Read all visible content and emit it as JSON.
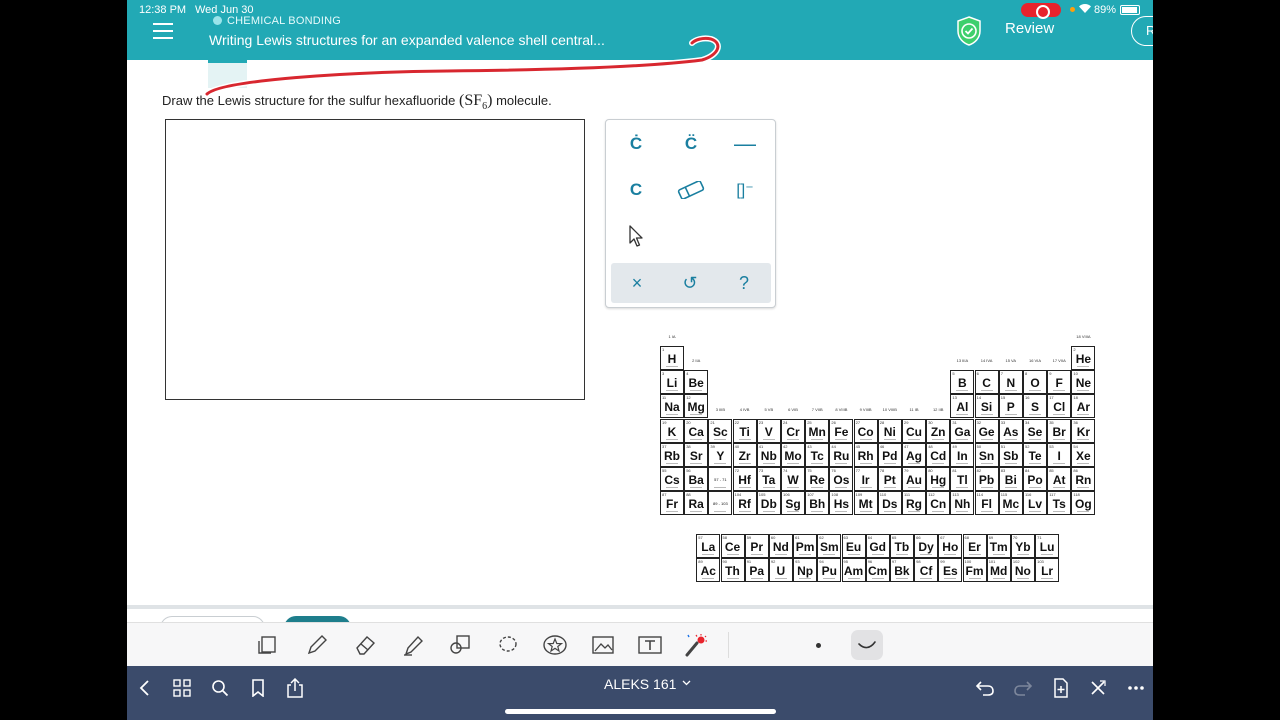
{
  "status_bar": {
    "time": "12:38 PM",
    "date": "Wed Jun 30",
    "battery": "89%"
  },
  "header": {
    "topic": "CHEMICAL BONDING",
    "title": "Writing Lewis structures for an expanded valence shell central...",
    "review_label": "Review",
    "right_button_label": "R",
    "accent": "#22a9b5"
  },
  "question": {
    "prefix": "Draw the Lewis structure for the sulfur hexafluoride",
    "formula_open": "(",
    "formula_main": "SF",
    "formula_sub": "6",
    "formula_close": ")",
    "suffix": "molecule."
  },
  "palette": {
    "tools": [
      {
        "id": "single-electron",
        "glyph": "Ċ",
        "icon": "single-dot-atom-icon"
      },
      {
        "id": "lone-pair",
        "glyph": "C̈",
        "icon": "lone-pair-atom-icon"
      },
      {
        "id": "bond",
        "glyph": "—",
        "icon": "bond-line-icon"
      },
      {
        "id": "atom",
        "glyph": "C",
        "icon": "atom-icon"
      },
      {
        "id": "eraser",
        "glyph": "",
        "icon": "eraser-icon"
      },
      {
        "id": "bracket",
        "glyph": "[]⁻",
        "icon": "bracket-charge-icon"
      },
      {
        "id": "select",
        "glyph": "",
        "icon": "cursor-icon"
      }
    ],
    "bottom": [
      {
        "id": "clear",
        "glyph": "×",
        "icon": "close-icon"
      },
      {
        "id": "undo",
        "glyph": "↺",
        "icon": "undo-icon"
      },
      {
        "id": "help",
        "glyph": "?",
        "icon": "help-icon"
      }
    ]
  },
  "periodic_table": {
    "main": [
      [
        {
          "n": 1,
          "s": "H",
          "c": 1
        },
        {
          "n": 2,
          "s": "He",
          "c": 18
        }
      ],
      [
        {
          "n": 3,
          "s": "Li",
          "c": 1
        },
        {
          "n": 4,
          "s": "Be",
          "c": 2
        },
        {
          "n": 5,
          "s": "B",
          "c": 13
        },
        {
          "n": 6,
          "s": "C",
          "c": 14
        },
        {
          "n": 7,
          "s": "N",
          "c": 15
        },
        {
          "n": 8,
          "s": "O",
          "c": 16
        },
        {
          "n": 9,
          "s": "F",
          "c": 17
        },
        {
          "n": 10,
          "s": "Ne",
          "c": 18
        }
      ],
      [
        {
          "n": 11,
          "s": "Na",
          "c": 1
        },
        {
          "n": 12,
          "s": "Mg",
          "c": 2
        },
        {
          "n": 13,
          "s": "Al",
          "c": 13
        },
        {
          "n": 14,
          "s": "Si",
          "c": 14
        },
        {
          "n": 15,
          "s": "P",
          "c": 15
        },
        {
          "n": 16,
          "s": "S",
          "c": 16
        },
        {
          "n": 17,
          "s": "Cl",
          "c": 17
        },
        {
          "n": 18,
          "s": "Ar",
          "c": 18
        }
      ],
      [
        {
          "n": 19,
          "s": "K",
          "c": 1
        },
        {
          "n": 20,
          "s": "Ca",
          "c": 2
        },
        {
          "n": 21,
          "s": "Sc",
          "c": 3
        },
        {
          "n": 22,
          "s": "Ti",
          "c": 4
        },
        {
          "n": 23,
          "s": "V",
          "c": 5
        },
        {
          "n": 24,
          "s": "Cr",
          "c": 6
        },
        {
          "n": 25,
          "s": "Mn",
          "c": 7
        },
        {
          "n": 26,
          "s": "Fe",
          "c": 8
        },
        {
          "n": 27,
          "s": "Co",
          "c": 9
        },
        {
          "n": 28,
          "s": "Ni",
          "c": 10
        },
        {
          "n": 29,
          "s": "Cu",
          "c": 11
        },
        {
          "n": 30,
          "s": "Zn",
          "c": 12
        },
        {
          "n": 31,
          "s": "Ga",
          "c": 13
        },
        {
          "n": 32,
          "s": "Ge",
          "c": 14
        },
        {
          "n": 33,
          "s": "As",
          "c": 15
        },
        {
          "n": 34,
          "s": "Se",
          "c": 16
        },
        {
          "n": 35,
          "s": "Br",
          "c": 17
        },
        {
          "n": 36,
          "s": "Kr",
          "c": 18
        }
      ],
      [
        {
          "n": 37,
          "s": "Rb",
          "c": 1
        },
        {
          "n": 38,
          "s": "Sr",
          "c": 2
        },
        {
          "n": 39,
          "s": "Y",
          "c": 3
        },
        {
          "n": 40,
          "s": "Zr",
          "c": 4
        },
        {
          "n": 41,
          "s": "Nb",
          "c": 5
        },
        {
          "n": 42,
          "s": "Mo",
          "c": 6
        },
        {
          "n": 43,
          "s": "Tc",
          "c": 7
        },
        {
          "n": 44,
          "s": "Ru",
          "c": 8
        },
        {
          "n": 45,
          "s": "Rh",
          "c": 9
        },
        {
          "n": 46,
          "s": "Pd",
          "c": 10
        },
        {
          "n": 47,
          "s": "Ag",
          "c": 11
        },
        {
          "n": 48,
          "s": "Cd",
          "c": 12
        },
        {
          "n": 49,
          "s": "In",
          "c": 13
        },
        {
          "n": 50,
          "s": "Sn",
          "c": 14
        },
        {
          "n": 51,
          "s": "Sb",
          "c": 15
        },
        {
          "n": 52,
          "s": "Te",
          "c": 16
        },
        {
          "n": 53,
          "s": "I",
          "c": 17
        },
        {
          "n": 54,
          "s": "Xe",
          "c": 18
        }
      ],
      [
        {
          "n": 55,
          "s": "Cs",
          "c": 1
        },
        {
          "n": 56,
          "s": "Ba",
          "c": 2
        },
        {
          "n": 0,
          "s": "57 - 71",
          "c": 3
        },
        {
          "n": 72,
          "s": "Hf",
          "c": 4
        },
        {
          "n": 73,
          "s": "Ta",
          "c": 5
        },
        {
          "n": 74,
          "s": "W",
          "c": 6
        },
        {
          "n": 75,
          "s": "Re",
          "c": 7
        },
        {
          "n": 76,
          "s": "Os",
          "c": 8
        },
        {
          "n": 77,
          "s": "Ir",
          "c": 9
        },
        {
          "n": 78,
          "s": "Pt",
          "c": 10
        },
        {
          "n": 79,
          "s": "Au",
          "c": 11
        },
        {
          "n": 80,
          "s": "Hg",
          "c": 12
        },
        {
          "n": 81,
          "s": "Tl",
          "c": 13
        },
        {
          "n": 82,
          "s": "Pb",
          "c": 14
        },
        {
          "n": 83,
          "s": "Bi",
          "c": 15
        },
        {
          "n": 84,
          "s": "Po",
          "c": 16
        },
        {
          "n": 85,
          "s": "At",
          "c": 17
        },
        {
          "n": 86,
          "s": "Rn",
          "c": 18
        }
      ],
      [
        {
          "n": 87,
          "s": "Fr",
          "c": 1
        },
        {
          "n": 88,
          "s": "Ra",
          "c": 2
        },
        {
          "n": 0,
          "s": "89 - 103",
          "c": 3
        },
        {
          "n": 104,
          "s": "Rf",
          "c": 4
        },
        {
          "n": 105,
          "s": "Db",
          "c": 5
        },
        {
          "n": 106,
          "s": "Sg",
          "c": 6
        },
        {
          "n": 107,
          "s": "Bh",
          "c": 7
        },
        {
          "n": 108,
          "s": "Hs",
          "c": 8
        },
        {
          "n": 109,
          "s": "Mt",
          "c": 9
        },
        {
          "n": 110,
          "s": "Ds",
          "c": 10
        },
        {
          "n": 111,
          "s": "Rg",
          "c": 11
        },
        {
          "n": 112,
          "s": "Cn",
          "c": 12
        },
        {
          "n": 113,
          "s": "Nh",
          "c": 13
        },
        {
          "n": 114,
          "s": "Fl",
          "c": 14
        },
        {
          "n": 115,
          "s": "Mc",
          "c": 15
        },
        {
          "n": 116,
          "s": "Lv",
          "c": 16
        },
        {
          "n": 117,
          "s": "Ts",
          "c": 17
        },
        {
          "n": 118,
          "s": "Og",
          "c": 18
        }
      ]
    ],
    "lanthanides": [
      {
        "n": 57,
        "s": "La"
      },
      {
        "n": 58,
        "s": "Ce"
      },
      {
        "n": 59,
        "s": "Pr"
      },
      {
        "n": 60,
        "s": "Nd"
      },
      {
        "n": 61,
        "s": "Pm"
      },
      {
        "n": 62,
        "s": "Sm"
      },
      {
        "n": 63,
        "s": "Eu"
      },
      {
        "n": 64,
        "s": "Gd"
      },
      {
        "n": 65,
        "s": "Tb"
      },
      {
        "n": 66,
        "s": "Dy"
      },
      {
        "n": 67,
        "s": "Ho"
      },
      {
        "n": 68,
        "s": "Er"
      },
      {
        "n": 69,
        "s": "Tm"
      },
      {
        "n": 70,
        "s": "Yb"
      },
      {
        "n": 71,
        "s": "Lu"
      }
    ],
    "actinides": [
      {
        "n": 89,
        "s": "Ac"
      },
      {
        "n": 90,
        "s": "Th"
      },
      {
        "n": 91,
        "s": "Pa"
      },
      {
        "n": 92,
        "s": "U"
      },
      {
        "n": 93,
        "s": "Np"
      },
      {
        "n": 94,
        "s": "Pu"
      },
      {
        "n": 95,
        "s": "Am"
      },
      {
        "n": 96,
        "s": "Cm"
      },
      {
        "n": 97,
        "s": "Bk"
      },
      {
        "n": 98,
        "s": "Cf"
      },
      {
        "n": 99,
        "s": "Es"
      },
      {
        "n": 100,
        "s": "Fm"
      },
      {
        "n": 101,
        "s": "Md"
      },
      {
        "n": 102,
        "s": "No"
      },
      {
        "n": 103,
        "s": "Lr"
      }
    ],
    "group_labels": {
      "1": "IA",
      "2": "IIA",
      "3": "IIIB",
      "4": "IVB",
      "5": "VB",
      "6": "VIB",
      "7": "VIIB",
      "8": "VIIIB",
      "9": "VIIIB",
      "10": "VIIIB",
      "11": "IB",
      "12": "IIB",
      "13": "IIIA",
      "14": "IVA",
      "15": "VA",
      "16": "VIA",
      "17": "VIIA",
      "18": "VIIIA"
    }
  },
  "annotation_toolbar": {
    "tools": [
      "scan-icon",
      "pen-icon",
      "eraser-icon",
      "highlighter-icon",
      "shapes-icon",
      "lasso-icon",
      "sticker-icon",
      "image-icon",
      "text-box-icon",
      "laser-pointer-icon"
    ]
  },
  "nav_bar": {
    "title": "ALEKS 161",
    "chevron": "⌄"
  }
}
